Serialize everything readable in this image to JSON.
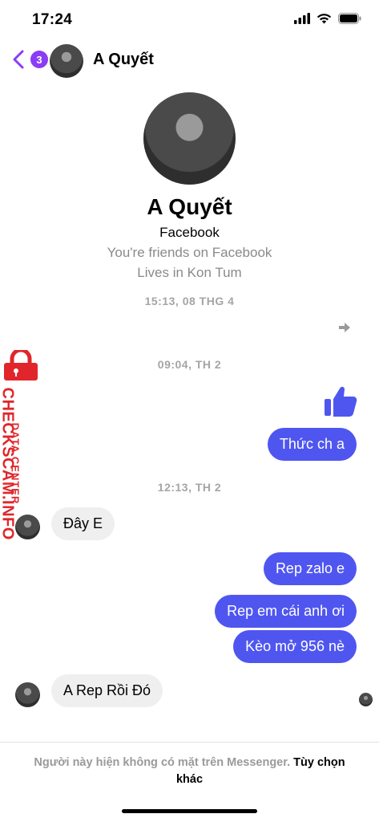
{
  "status_bar": {
    "time": "17:24"
  },
  "header": {
    "back_badge": "3",
    "name": "A Quyết"
  },
  "profile": {
    "name": "A Quyết",
    "platform": "Facebook",
    "friends": "You're friends on Facebook",
    "location": "Lives in Kon Tum"
  },
  "timestamps": [
    "15:13, 08 THG 4",
    "09:04, TH 2",
    "12:13, TH 2"
  ],
  "messages": {
    "out_1": "Thức ch a",
    "in_1": "Đây E",
    "out_2": "Rep zalo e",
    "out_3": "Rep em cái anh ơi",
    "out_4": "Kèo mở 956 nè",
    "in_2": "A Rep Rồi Đó"
  },
  "watermark": {
    "top": "DATA CENTER",
    "main": "CHECKSCAM.INFO"
  },
  "footer": {
    "notice": "Người này hiện không có mặt trên Messenger.",
    "link": "Tùy chọn khác"
  },
  "colors": {
    "outgoing": "#4f56f0",
    "incoming": "#efefef",
    "accent": "#8b3cf5",
    "watermark": "#e0262b"
  },
  "icons": [
    "wifi-icon",
    "signal-icon",
    "battery-icon",
    "back-chevron-icon",
    "thumbs-up-icon",
    "forward-arrow-icon"
  ]
}
